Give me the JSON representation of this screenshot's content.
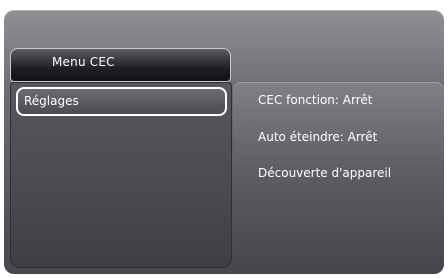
{
  "menu": {
    "title": "Menu CEC",
    "items": [
      {
        "label": "Réglages",
        "selected": true
      }
    ]
  },
  "submenu": {
    "options": [
      {
        "label": "CEC fonction: Arrêt"
      },
      {
        "label": "Auto éteindre: Arrêt"
      },
      {
        "label": "Découverte d'appareil"
      }
    ]
  }
}
